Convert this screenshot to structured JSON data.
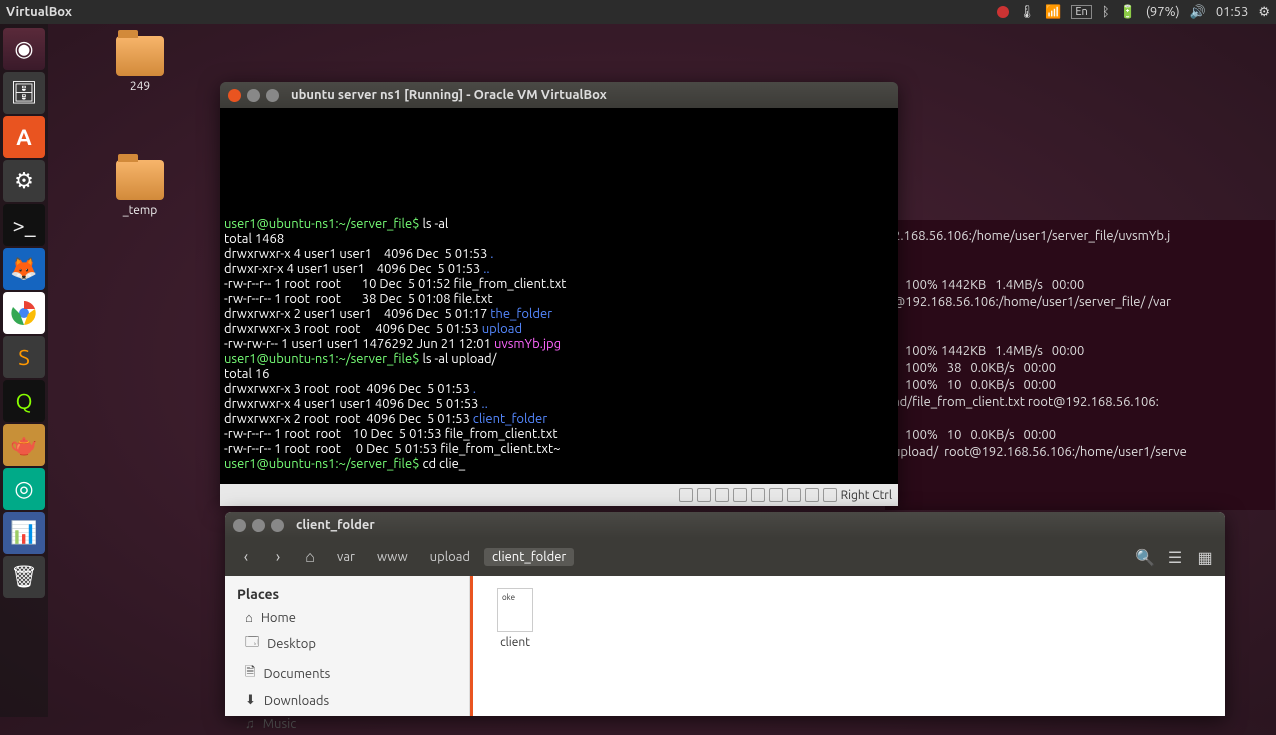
{
  "topbar": {
    "title": "VirtualBox",
    "lang": "En",
    "battery": "(97%)",
    "time": "01:53"
  },
  "desktop": {
    "icon1": "249",
    "icon2": "_temp"
  },
  "bgterm": {
    "l1": "2.168.56.106:/home/user1/server_file/uvsmYb.j",
    "l2": "    100% 1442KB   1.4MB/s   00:00",
    "l3": "@192.168.56.106:/home/user1/server_file/ /var",
    "l4": "    100% 1442KB   1.4MB/s   00:00",
    "l5": "    100%   38   0.0KB/s   00:00",
    "l6": "    100%   10   0.0KB/s   00:00",
    "l7": "ad/file_from_client.txt root@192.168.56.106:",
    "l8": "    100%   10   0.0KB/s   00:00",
    "l9": "upload/  root@192.168.56.106:/home/user1/serve"
  },
  "vm": {
    "title": "ubuntu server ns1 [Running] - Oracle VM VirtualBox",
    "hostkey": "Right Ctrl",
    "lines": {
      "p1": "user1@ubuntu-ns1:~/server_file$ ",
      "c1": "ls -al",
      "t1": "total 1468",
      "r1a": "drwxrwxr-x 4 user1 user1    4096 Dec  5 01:53 ",
      "r1b": ".",
      "r2a": "drwxr-xr-x 4 user1 user1    4096 Dec  5 01:53 ",
      "r2b": "..",
      "r3": "-rw-r--r-- 1 root  root       10 Dec  5 01:52 file_from_client.txt",
      "r4": "-rw-r--r-- 1 root  root       38 Dec  5 01:08 file.txt",
      "r5a": "drwxrwxr-x 2 user1 user1    4096 Dec  5 01:17 ",
      "r5b": "the_folder",
      "r6a": "drwxrwxr-x 3 root  root     4096 Dec  5 01:53 ",
      "r6b": "upload",
      "r7a": "-rw-rw-r-- 1 user1 user1 1476292 Jun 21 12:01 ",
      "r7b": "uvsmYb.jpg",
      "p2": "user1@ubuntu-ns1:~/server_file$ ",
      "c2": "ls -al upload/",
      "t2": "total 16",
      "r8a": "drwxrwxr-x 3 root  root  4096 Dec  5 01:53 ",
      "r8b": ".",
      "r9a": "drwxrwxr-x 4 user1 user1 4096 Dec  5 01:53 ",
      "r9b": "..",
      "r10a": "drwxrwxr-x 2 root  root  4096 Dec  5 01:53 ",
      "r10b": "client_folder",
      "r11": "-rw-r--r-- 1 root  root    10 Dec  5 01:53 file_from_client.txt",
      "r12": "-rw-r--r-- 1 root  root     0 Dec  5 01:53 file_from_client.txt~",
      "p3": "user1@ubuntu-ns1:~/server_file$ ",
      "c3": "cd clie_"
    }
  },
  "fm": {
    "title": "client_folder",
    "path": {
      "seg1": "var",
      "seg2": "www",
      "seg3": "upload",
      "seg4": "client_folder"
    },
    "sidebar": {
      "hdr": "Places",
      "home": "Home",
      "desktop": "Desktop",
      "docs": "Documents",
      "down": "Downloads",
      "music": "Music"
    },
    "file": "client"
  }
}
